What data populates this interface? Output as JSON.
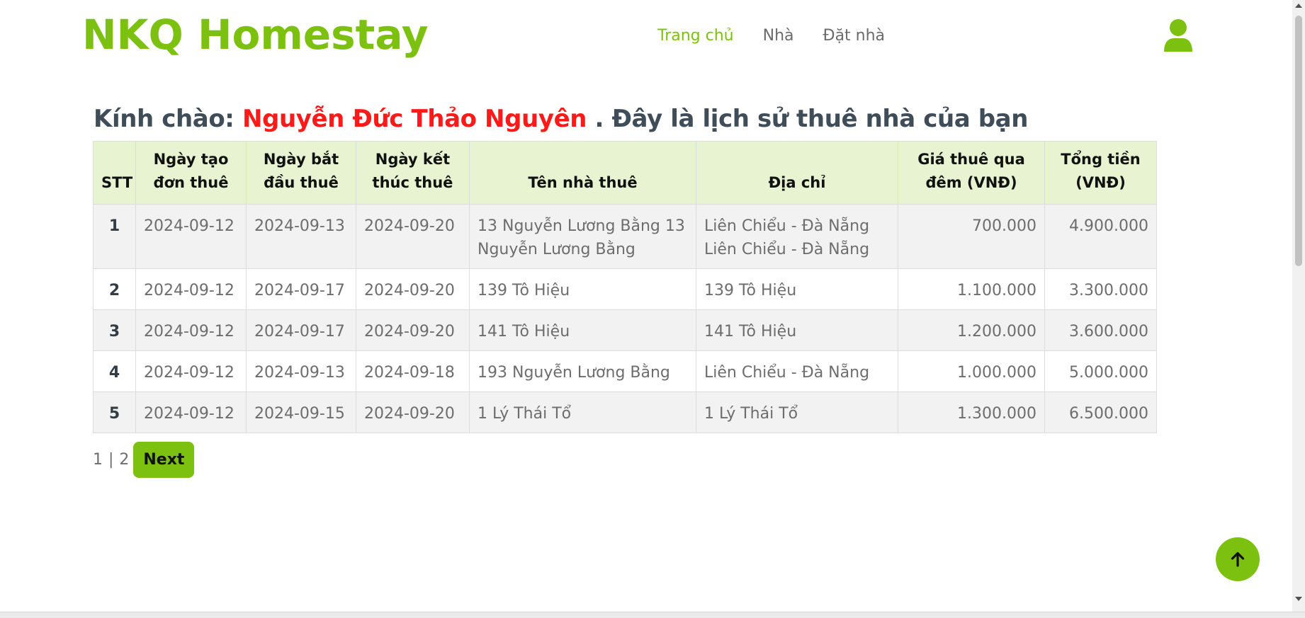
{
  "header": {
    "brand": "NKQ Homestay",
    "nav": [
      {
        "label": "Trang chủ",
        "active": true
      },
      {
        "label": "Nhà",
        "active": false
      },
      {
        "label": "Đặt nhà",
        "active": false
      }
    ],
    "user_icon": "user-icon"
  },
  "greeting": {
    "prefix": "Kính chào: ",
    "name": "Nguyễn Đức Thảo Nguyên",
    "suffix": " . Đây là lịch sử thuê nhà của bạn"
  },
  "table": {
    "headers": [
      "STT",
      "Ngày tạo đơn thuê",
      "Ngày bắt đầu thuê",
      "Ngày kết thúc thuê",
      "Tên nhà thuê",
      "Địa chỉ",
      "Giá thuê qua đêm (VNĐ)",
      "Tổng tiền (VNĐ)"
    ],
    "rows": [
      {
        "stt": "1",
        "created": "2024-09-12",
        "start": "2024-09-13",
        "end": "2024-09-20",
        "house": "13 Nguyễn Lương Bằng 13 Nguyễn Lương Bằng",
        "address": "Liên Chiểu - Đà Nẵng Liên Chiểu - Đà Nẵng",
        "price": "700.000",
        "total": "4.900.000"
      },
      {
        "stt": "2",
        "created": "2024-09-12",
        "start": "2024-09-17",
        "end": "2024-09-20",
        "house": "139 Tô Hiệu",
        "address": "139 Tô Hiệu",
        "price": "1.100.000",
        "total": "3.300.000"
      },
      {
        "stt": "3",
        "created": "2024-09-12",
        "start": "2024-09-17",
        "end": "2024-09-20",
        "house": "141 Tô Hiệu",
        "address": "141 Tô Hiệu",
        "price": "1.200.000",
        "total": "3.600.000"
      },
      {
        "stt": "4",
        "created": "2024-09-12",
        "start": "2024-09-13",
        "end": "2024-09-18",
        "house": "193 Nguyễn Lương Bằng",
        "address": "Liên Chiểu - Đà Nẵng",
        "price": "1.000.000",
        "total": "5.000.000"
      },
      {
        "stt": "5",
        "created": "2024-09-12",
        "start": "2024-09-15",
        "end": "2024-09-20",
        "house": "1 Lý Thái Tổ",
        "address": "1 Lý Thái Tổ",
        "price": "1.300.000",
        "total": "6.500.000"
      }
    ]
  },
  "pagination": {
    "pages": [
      "1",
      "2"
    ],
    "separator": "|",
    "next_label": "Next"
  },
  "back_to_top_icon": "arrow-up-icon",
  "colors": {
    "accent": "#7cc10f",
    "name_highlight": "#ff1a1a",
    "header_bg": "#e8f4d1"
  }
}
